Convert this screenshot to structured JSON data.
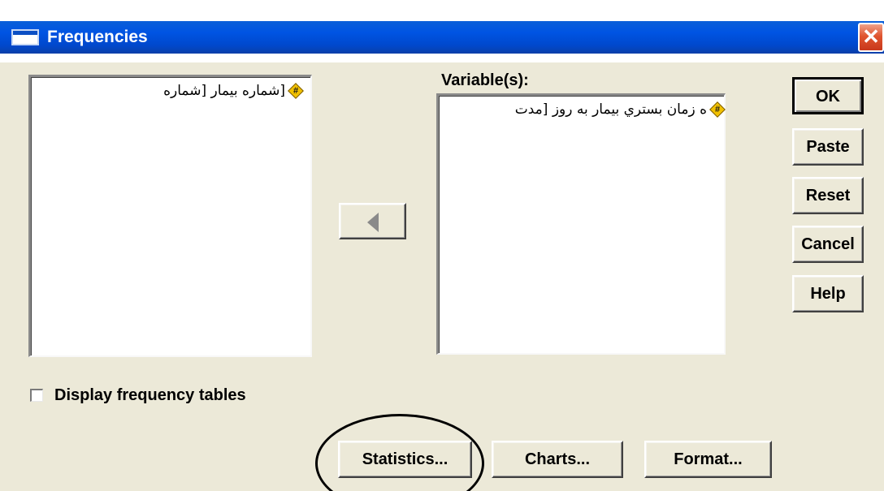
{
  "window": {
    "title": "Frequencies",
    "close_label": "✕"
  },
  "source_list": {
    "items": [
      {
        "label": "[شماره بيمار [شماره",
        "icon": "scale-variable-icon",
        "icon_glyph": "#"
      }
    ]
  },
  "target_list": {
    "heading": "Variable(s):",
    "items": [
      {
        "label": "ه زمان بستري بيمار به روز [مدت",
        "icon": "scale-variable-icon",
        "icon_glyph": "#"
      }
    ]
  },
  "move_button": {
    "icon": "arrow-left-icon"
  },
  "side_buttons": {
    "ok": "OK",
    "paste": "Paste",
    "reset": "Reset",
    "cancel": "Cancel",
    "help": "Help"
  },
  "checkbox": {
    "label": "Display frequency tables",
    "checked": false
  },
  "bottom_buttons": {
    "statistics": "Statistics...",
    "charts": "Charts...",
    "format": "Format..."
  },
  "colors": {
    "dialog_bg": "#ece9d8",
    "titlebar": "#0054e3",
    "close_button": "#e0552f",
    "variable_icon": "#f2c100"
  }
}
